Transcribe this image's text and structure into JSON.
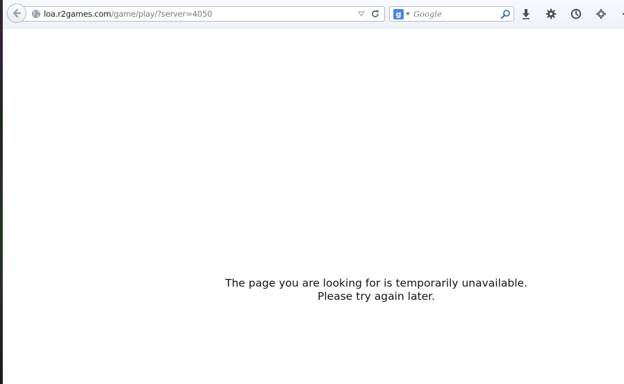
{
  "browser": {
    "url": {
      "host": "loa.r2games.com",
      "path": "/game/play/?server=4050"
    },
    "search": {
      "placeholder": "Google",
      "engine_icon_label": "g"
    },
    "icons": {
      "back": "back-arrow-icon",
      "site": "globe-icon",
      "history_dropdown": "dropmarker-icon",
      "reload": "reload-icon",
      "search_engine": "google-icon",
      "search_go": "magnifier-icon",
      "downloads": "download-arrow-icon",
      "settings": "gear-icon",
      "history": "clock-icon",
      "move": "move-arrows-icon"
    }
  },
  "page": {
    "message_line1": "The page you are looking for is temporarily unavailable.",
    "message_line2": "Please try again later."
  }
}
